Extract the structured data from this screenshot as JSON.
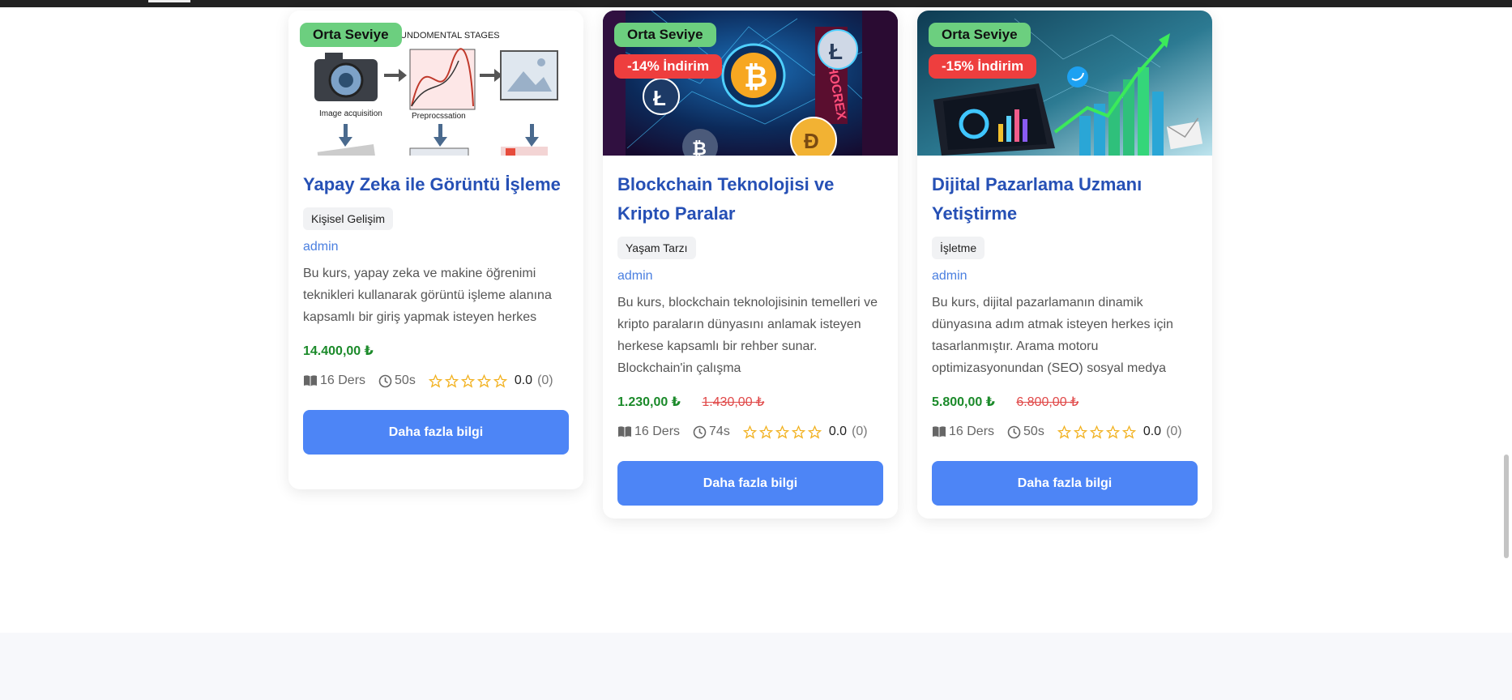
{
  "courses": [
    {
      "level": "Orta Seviye",
      "discount": "",
      "title": "Yapay Zeka ile Görüntü İşleme",
      "category": "Kişisel Gelişim",
      "author": "admin",
      "description": "Bu kurs, yapay zeka ve makine öğrenimi teknikleri kullanarak görüntü işleme alanına kapsamlı bir giriş yapmak isteyen herkes",
      "price": "14.400,00 ₺",
      "old_price": "",
      "lessons": "16 Ders",
      "duration": "50s",
      "rating": "0.0",
      "rating_count": "(0)",
      "rating_value": 0,
      "button_label": "Daha fazla bilgi",
      "image_text": {
        "heading": "UNDOMENTAL STAGES",
        "step1": "Image acquisition",
        "step2": "Preprocssation"
      }
    },
    {
      "level": "Orta Seviye",
      "discount": "-14% İndirim",
      "title": "Blockchain Teknolojisi ve Kripto Paralar",
      "category": "Yaşam Tarzı",
      "author": "admin",
      "description": "Bu kurs, blockchain teknolojisinin temelleri ve kripto paraların dünyasını anlamak isteyen herkese kapsamlı bir rehber sunar. Blockchain'in çalışma",
      "price": "1.230,00 ₺",
      "old_price": "1.430,00 ₺",
      "lessons": "16 Ders",
      "duration": "74s",
      "rating": "0.0",
      "rating_count": "(0)",
      "rating_value": 0,
      "button_label": "Daha fazla bilgi"
    },
    {
      "level": "Orta Seviye",
      "discount": "-15% İndirim",
      "title": "Dijital Pazarlama Uzmanı Yetiştirme",
      "category": "İşletme",
      "author": "admin",
      "description": "Bu kurs, dijital pazarlamanın dinamik dünyasına adım atmak isteyen herkes için tasarlanmıştır. Arama motoru optimizasyonundan (SEO) sosyal medya",
      "price": "5.800,00 ₺",
      "old_price": "6.800,00 ₺",
      "lessons": "16 Ders",
      "duration": "50s",
      "rating": "0.0",
      "rating_count": "(0)",
      "rating_value": 0,
      "button_label": "Daha fazla bilgi"
    }
  ],
  "colors": {
    "level_badge": "#6ccf7f",
    "discount_badge": "#ee3e3e",
    "title": "#2650b5",
    "price": "#1b8a2a",
    "old_price": "#e04848",
    "button": "#4d85f6",
    "star": "#f2b11e"
  },
  "icons": {
    "lessons": "book-icon",
    "duration": "clock-icon",
    "rating": "star-icon"
  }
}
